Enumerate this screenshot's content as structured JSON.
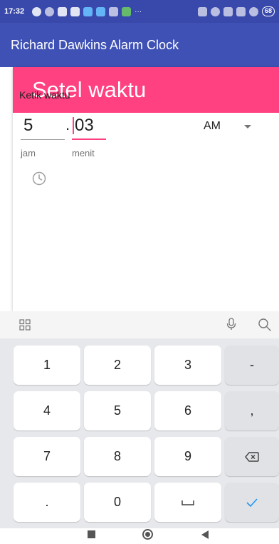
{
  "status_bar": {
    "time": "17:32",
    "more": "···",
    "battery": "68"
  },
  "app_bar": {
    "title": "Richard Dawkins Alarm Clock"
  },
  "dialog": {
    "title": "Setel waktu",
    "type_label": "Ketik waktu",
    "hour": {
      "value": "5",
      "caption": "jam"
    },
    "separator": ".",
    "minute": {
      "value": "03",
      "caption": "menit"
    },
    "ampm": {
      "selected": "AM"
    },
    "colors": {
      "accent": "#ff4081",
      "primary": "#3f51b5"
    }
  },
  "keyboard": {
    "toolbar_icons": [
      "grid-icon",
      "mic-icon",
      "search-icon"
    ],
    "keys": [
      [
        "1",
        "2",
        "3",
        "-"
      ],
      [
        "4",
        "5",
        "6",
        ","
      ],
      [
        "7",
        "8",
        "9",
        "backspace"
      ],
      [
        ".",
        "0",
        "space",
        "done"
      ]
    ]
  },
  "nav_bar": {
    "icons": [
      "recents-icon",
      "home-icon",
      "back-icon"
    ]
  }
}
